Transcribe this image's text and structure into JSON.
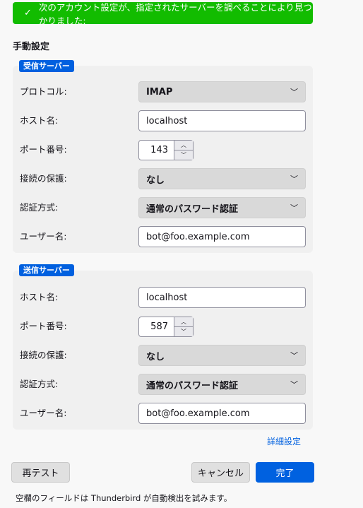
{
  "banner": {
    "icon": "checkmark-icon",
    "text": "次のアカウント設定が、指定されたサーバーを調べることにより見つかりました:",
    "color": "#12bc00"
  },
  "title": "手動設定",
  "incoming": {
    "legend": "受信サーバー",
    "protocol_label": "プロトコル:",
    "protocol": "IMAP",
    "host_label": "ホスト名:",
    "host": "localhost",
    "port_label": "ポート番号:",
    "port": "143",
    "security_label": "接続の保護:",
    "security": "なし",
    "auth_label": "認証方式:",
    "auth": "通常のパスワード認証",
    "user_label": "ユーザー名:",
    "user": "bot@foo.example.com"
  },
  "outgoing": {
    "legend": "送信サーバー",
    "host_label": "ホスト名:",
    "host": "localhost",
    "port_label": "ポート番号:",
    "port": "587",
    "security_label": "接続の保護:",
    "security": "なし",
    "auth_label": "認証方式:",
    "auth": "通常のパスワード認証",
    "user_label": "ユーザー名:",
    "user": "bot@foo.example.com"
  },
  "advanced_link": "詳細設定",
  "buttons": {
    "retest": "再テスト",
    "cancel": "キャンセル",
    "done": "完了"
  },
  "footer": "空欄のフィールドは Thunderbird が自動検出を試みます。",
  "accent": "#0060df"
}
